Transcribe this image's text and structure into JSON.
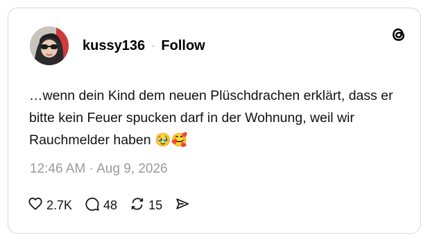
{
  "post": {
    "username": "kussy136",
    "separator": "·",
    "follow_label": "Follow",
    "text": "…wenn dein Kind dem neuen Plüschdrachen erklärt, dass er bitte kein Feuer spucken darf in der Wohnung, weil wir Rauchmelder haben",
    "emojis": "🥹🥰",
    "timestamp": "12:46 AM · Aug 9, 2026"
  },
  "actions": {
    "likes": "2.7K",
    "comments": "48",
    "reposts": "15"
  },
  "icons": {
    "logo": "threads-logo-icon",
    "like": "heart-icon",
    "comment": "comment-bubble-icon",
    "repost": "repost-icon",
    "share": "send-icon"
  },
  "colors": {
    "border": "#d9d9d9",
    "muted": "#9a9a9a"
  }
}
